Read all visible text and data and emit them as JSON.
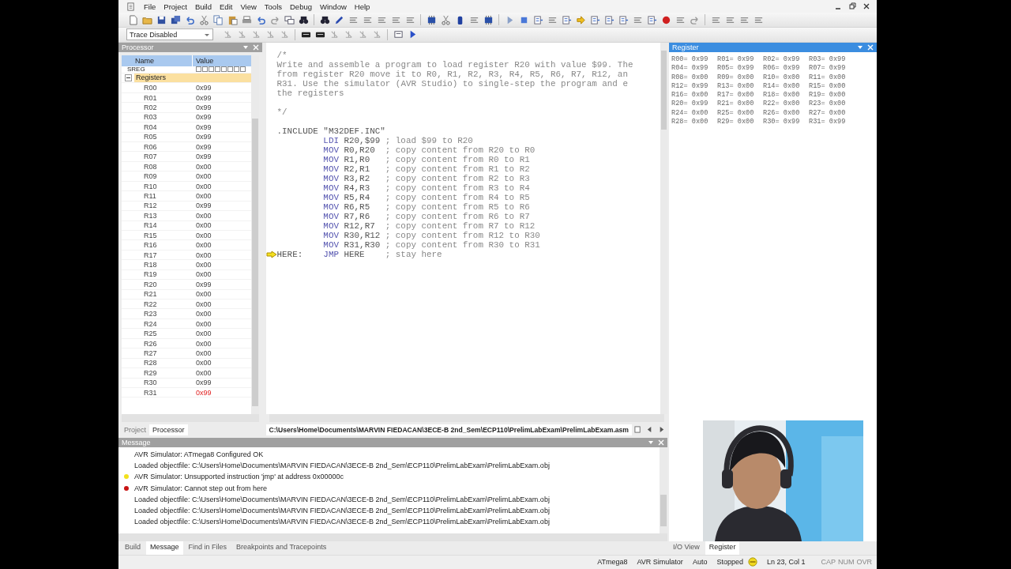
{
  "menu": [
    "File",
    "Project",
    "Build",
    "Edit",
    "View",
    "Tools",
    "Debug",
    "Window",
    "Help"
  ],
  "trace": {
    "value": "Trace Disabled"
  },
  "processor": {
    "title": "Processor",
    "columns": [
      "Name",
      "Value"
    ],
    "sreg": {
      "label": "SREG",
      "flags": [
        {
          "checked": false
        },
        {
          "checked": false
        },
        {
          "checked": false
        },
        {
          "checked": false
        },
        {
          "checked": false
        },
        {
          "checked": false
        },
        {
          "checked": false
        },
        {
          "checked": false
        }
      ]
    },
    "group": {
      "label": "Registers",
      "expanded": true
    },
    "registers": [
      {
        "name": "R00",
        "value": "0x99",
        "changed": false
      },
      {
        "name": "R01",
        "value": "0x99",
        "changed": false
      },
      {
        "name": "R02",
        "value": "0x99",
        "changed": false
      },
      {
        "name": "R03",
        "value": "0x99",
        "changed": false
      },
      {
        "name": "R04",
        "value": "0x99",
        "changed": false
      },
      {
        "name": "R05",
        "value": "0x99",
        "changed": false
      },
      {
        "name": "R06",
        "value": "0x99",
        "changed": false
      },
      {
        "name": "R07",
        "value": "0x99",
        "changed": false
      },
      {
        "name": "R08",
        "value": "0x00",
        "changed": false
      },
      {
        "name": "R09",
        "value": "0x00",
        "changed": false
      },
      {
        "name": "R10",
        "value": "0x00",
        "changed": false
      },
      {
        "name": "R11",
        "value": "0x00",
        "changed": false
      },
      {
        "name": "R12",
        "value": "0x99",
        "changed": false
      },
      {
        "name": "R13",
        "value": "0x00",
        "changed": false
      },
      {
        "name": "R14",
        "value": "0x00",
        "changed": false
      },
      {
        "name": "R15",
        "value": "0x00",
        "changed": false
      },
      {
        "name": "R16",
        "value": "0x00",
        "changed": false
      },
      {
        "name": "R17",
        "value": "0x00",
        "changed": false
      },
      {
        "name": "R18",
        "value": "0x00",
        "changed": false
      },
      {
        "name": "R19",
        "value": "0x00",
        "changed": false
      },
      {
        "name": "R20",
        "value": "0x99",
        "changed": false
      },
      {
        "name": "R21",
        "value": "0x00",
        "changed": false
      },
      {
        "name": "R22",
        "value": "0x00",
        "changed": false
      },
      {
        "name": "R23",
        "value": "0x00",
        "changed": false
      },
      {
        "name": "R24",
        "value": "0x00",
        "changed": false
      },
      {
        "name": "R25",
        "value": "0x00",
        "changed": false
      },
      {
        "name": "R26",
        "value": "0x00",
        "changed": false
      },
      {
        "name": "R27",
        "value": "0x00",
        "changed": false
      },
      {
        "name": "R28",
        "value": "0x00",
        "changed": false
      },
      {
        "name": "R29",
        "value": "0x00",
        "changed": false
      },
      {
        "name": "R30",
        "value": "0x99",
        "changed": false
      },
      {
        "name": "R31",
        "value": "0x99",
        "changed": true
      }
    ],
    "tabs": [
      {
        "label": "Project",
        "selected": false
      },
      {
        "label": "Processor",
        "selected": true
      }
    ]
  },
  "editor": {
    "lines": [
      {
        "kind": "comment",
        "text": "/*"
      },
      {
        "kind": "comment",
        "text": "Write and assemble a program to load register R20 with value $99. The"
      },
      {
        "kind": "comment",
        "text": "from register R20 move it to R0, R1, R2, R3, R4, R5, R6, R7, R12, an"
      },
      {
        "kind": "comment",
        "text": "R31. Use the simulator (AVR Studio) to single-step the program and e"
      },
      {
        "kind": "comment",
        "text": "the registers"
      },
      {
        "kind": "blank"
      },
      {
        "kind": "comment",
        "text": "*/"
      },
      {
        "kind": "blank"
      },
      {
        "kind": "directive",
        "text": ".INCLUDE \"M32DEF.INC\""
      },
      {
        "kind": "instr",
        "mnemonic": "LDI",
        "operands": "R20,$99",
        "comment": "; load $99 to R20",
        "current": false
      },
      {
        "kind": "instr",
        "mnemonic": "MOV",
        "operands": "R0,R20",
        "comment": "; copy content from R20 to R0",
        "current": false
      },
      {
        "kind": "instr",
        "mnemonic": "MOV",
        "operands": "R1,R0",
        "comment": "; copy content from R0 to R1",
        "current": false
      },
      {
        "kind": "instr",
        "mnemonic": "MOV",
        "operands": "R2,R1",
        "comment": "; copy content from R1 to R2",
        "current": false
      },
      {
        "kind": "instr",
        "mnemonic": "MOV",
        "operands": "R3,R2",
        "comment": "; copy content from R2 to R3",
        "current": false
      },
      {
        "kind": "instr",
        "mnemonic": "MOV",
        "operands": "R4,R3",
        "comment": "; copy content from R3 to R4",
        "current": false
      },
      {
        "kind": "instr",
        "mnemonic": "MOV",
        "operands": "R5,R4",
        "comment": "; copy content from R4 to R5",
        "current": false
      },
      {
        "kind": "instr",
        "mnemonic": "MOV",
        "operands": "R6,R5",
        "comment": "; copy content from R5 to R6",
        "current": false
      },
      {
        "kind": "instr",
        "mnemonic": "MOV",
        "operands": "R7,R6",
        "comment": "; copy content from R6 to R7",
        "current": false
      },
      {
        "kind": "instr",
        "mnemonic": "MOV",
        "operands": "R12,R7",
        "comment": "; copy content from R7 to R12",
        "current": false
      },
      {
        "kind": "instr",
        "mnemonic": "MOV",
        "operands": "R30,R12",
        "comment": "; copy content from R12 to R30",
        "current": false
      },
      {
        "kind": "instr",
        "mnemonic": "MOV",
        "operands": "R31,R30",
        "comment": "; copy content from R30 to R31",
        "current": false
      },
      {
        "kind": "instr",
        "label": "HERE:",
        "mnemonic": "JMP",
        "operands": "HERE",
        "comment": "; stay here",
        "current": true
      }
    ],
    "file_tab": {
      "label": "C:\\Users\\Home\\Documents\\MARVIN FIEDACAN\\3ECE-B 2nd_Sem\\ECP110\\PrelimLabExam\\PrelimLabExam.asm",
      "selected": true
    }
  },
  "register_view": {
    "title": "Register",
    "entries": [
      "R00= 0x99",
      "R01= 0x99",
      "R02= 0x99",
      "R03= 0x99",
      "R04= 0x99",
      "R05= 0x99",
      "R06= 0x99",
      "R07= 0x99",
      "R08= 0x00",
      "R09= 0x00",
      "R10= 0x00",
      "R11= 0x00",
      "R12= 0x99",
      "R13= 0x00",
      "R14= 0x00",
      "R15= 0x00",
      "R16= 0x00",
      "R17= 0x00",
      "R18= 0x00",
      "R19= 0x00",
      "R20= 0x99",
      "R21= 0x00",
      "R22= 0x00",
      "R23= 0x00",
      "R24= 0x00",
      "R25= 0x00",
      "R26= 0x00",
      "R27= 0x00",
      "R28= 0x00",
      "R29= 0x00",
      "R30= 0x99",
      "R31= 0x99"
    ],
    "tabs": [
      {
        "label": "I/O View",
        "selected": false
      },
      {
        "label": "Register",
        "selected": true
      }
    ]
  },
  "messages": {
    "title": "Message",
    "items": [
      {
        "kind": "info",
        "text": "AVR Simulator: ATmega8 Configured OK"
      },
      {
        "kind": "info",
        "text": "Loaded objectfile: C:\\Users\\Home\\Documents\\MARVIN FIEDACAN\\3ECE-B 2nd_Sem\\ECP110\\PrelimLabExam\\PrelimLabExam.obj"
      },
      {
        "kind": "warning",
        "text": "AVR Simulator: Unsupported instruction 'jmp' at address 0x00000c"
      },
      {
        "kind": "error",
        "text": "AVR Simulator: Cannot step out from here"
      },
      {
        "kind": "info",
        "text": "Loaded objectfile: C:\\Users\\Home\\Documents\\MARVIN FIEDACAN\\3ECE-B 2nd_Sem\\ECP110\\PrelimLabExam\\PrelimLabExam.obj"
      },
      {
        "kind": "info",
        "text": "Loaded objectfile: C:\\Users\\Home\\Documents\\MARVIN FIEDACAN\\3ECE-B 2nd_Sem\\ECP110\\PrelimLabExam\\PrelimLabExam.obj"
      },
      {
        "kind": "info",
        "text": "Loaded objectfile: C:\\Users\\Home\\Documents\\MARVIN FIEDACAN\\3ECE-B 2nd_Sem\\ECP110\\PrelimLabExam\\PrelimLabExam.obj"
      }
    ],
    "tabs": [
      {
        "label": "Build",
        "selected": false
      },
      {
        "label": "Message",
        "selected": true
      },
      {
        "label": "Find in Files",
        "selected": false
      },
      {
        "label": "Breakpoints and Tracepoints",
        "selected": false
      }
    ]
  },
  "status_bar": {
    "device": "ATmega8",
    "platform": "AVR Simulator",
    "mode": "Auto",
    "state": "Stopped",
    "position": "Ln 23, Col 1",
    "keys": [
      "CAP",
      "NUM",
      "OVR"
    ]
  }
}
